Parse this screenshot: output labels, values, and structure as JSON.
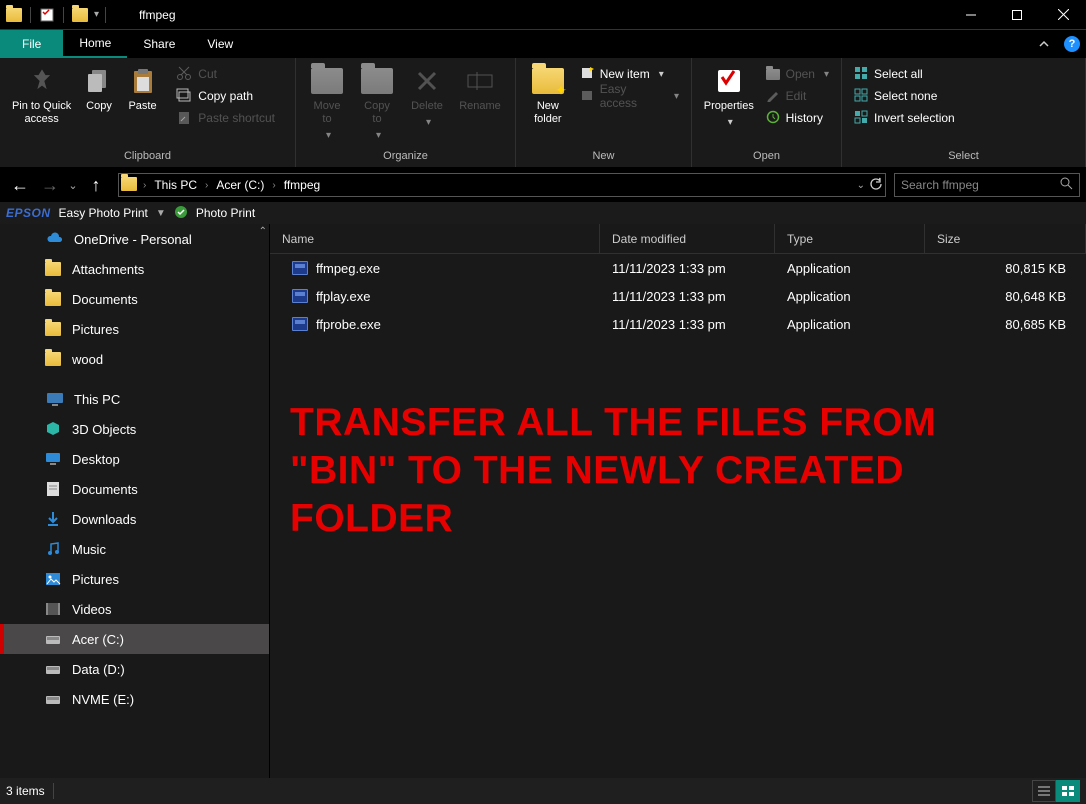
{
  "titlebar": {
    "title": "ffmpeg"
  },
  "tabs": {
    "file": "File",
    "home": "Home",
    "share": "Share",
    "view": "View"
  },
  "ribbon": {
    "clipboard": {
      "label": "Clipboard",
      "pin": "Pin to Quick\naccess",
      "copy": "Copy",
      "paste": "Paste",
      "cut": "Cut",
      "copy_path": "Copy path",
      "paste_shortcut": "Paste shortcut"
    },
    "organize": {
      "label": "Organize",
      "move_to": "Move\nto",
      "copy_to": "Copy\nto",
      "delete": "Delete",
      "rename": "Rename"
    },
    "new": {
      "label": "New",
      "new_folder": "New\nfolder",
      "new_item": "New item",
      "easy_access": "Easy access"
    },
    "open": {
      "label": "Open",
      "properties": "Properties",
      "open": "Open",
      "edit": "Edit",
      "history": "History"
    },
    "select": {
      "label": "Select",
      "select_all": "Select all",
      "select_none": "Select none",
      "invert": "Invert selection"
    }
  },
  "breadcrumb": {
    "this_pc": "This PC",
    "drive": "Acer (C:)",
    "folder": "ffmpeg"
  },
  "search": {
    "placeholder": "Search ffmpeg"
  },
  "epson": {
    "logo": "EPSON",
    "easy": "Easy Photo Print",
    "photo": "Photo Print"
  },
  "tree": {
    "onedrive": "OneDrive - Personal",
    "attachments": "Attachments",
    "documents": "Documents",
    "pictures": "Pictures",
    "wood": "wood",
    "this_pc": "This PC",
    "objects3d": "3D Objects",
    "desktop": "Desktop",
    "documents2": "Documents",
    "downloads": "Downloads",
    "music": "Music",
    "pictures2": "Pictures",
    "videos": "Videos",
    "acer": "Acer (C:)",
    "data": "Data (D:)",
    "nvme": "NVME (E:)"
  },
  "columns": {
    "name": "Name",
    "date": "Date modified",
    "type": "Type",
    "size": "Size"
  },
  "files": [
    {
      "name": "ffmpeg.exe",
      "date": "11/11/2023 1:33 pm",
      "type": "Application",
      "size": "80,815 KB"
    },
    {
      "name": "ffplay.exe",
      "date": "11/11/2023 1:33 pm",
      "type": "Application",
      "size": "80,648 KB"
    },
    {
      "name": "ffprobe.exe",
      "date": "11/11/2023 1:33 pm",
      "type": "Application",
      "size": "80,685 KB"
    }
  ],
  "overlay": "TRANSFER ALL THE FILES FROM \"BIN\" TO THE NEWLY CREATED FOLDER",
  "statusbar": {
    "count": "3 items"
  }
}
